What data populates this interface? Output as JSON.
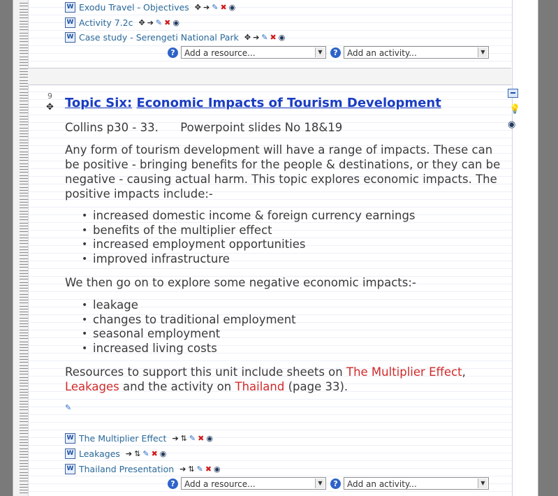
{
  "top_resources": [
    {
      "label": "Exodu Travel - Objectives"
    },
    {
      "label": "Activity 7.2c"
    },
    {
      "label": "Case study - Serengeti National Park"
    }
  ],
  "add_resource_placeholder": "Add a resource...",
  "add_activity_placeholder": "Add an activity...",
  "help_glyph": "?",
  "topic": {
    "number": "9",
    "title_prefix": "Topic Six:",
    "title_main": "Economic Impacts of Tourism Development",
    "source_line": "Collins p30 - 33.      Powerpoint slides No 18&19",
    "intro": "Any form of tourism development will have a range of impacts. These can be positive - bringing benefits for the people & destinations, or they can be negative - causing actual harm. This topic explores economic impacts. The positive impacts include:-",
    "positive": [
      "increased domestic income & foreign currency earnings",
      "benefits of the multiplier effect",
      "increased employment opportunities",
      "improved infrastructure"
    ],
    "negative_intro": "We then go on to explore some negative economic impacts:-",
    "negative": [
      "leakage",
      "changes to traditional employment",
      "seasonal employment",
      "increased living costs"
    ],
    "resources_sentence": {
      "part1": "Resources to support this unit include sheets on ",
      "link1": "The Multiplier Effect",
      "part2": ",",
      "link2": "Leakages",
      "part3": " and the activity on ",
      "link3": "Thailand",
      "part4": " (page 33)."
    }
  },
  "bottom_resources": [
    {
      "label": "The Multiplier Effect"
    },
    {
      "label": "Leakages"
    },
    {
      "label": "Thailand Presentation"
    }
  ],
  "colors": {
    "link": "#1a3dc2",
    "resource_link": "#2b6a9a",
    "red_link": "#d02a2a",
    "delete": "#d01b1b"
  },
  "icons": [
    "word-doc-icon",
    "move-icon",
    "indent-arrow-icon",
    "edit-icon",
    "delete-icon",
    "visibility-eye-icon",
    "help-icon",
    "collapse-icon",
    "lightbulb-icon",
    "edit-summary-icon"
  ]
}
